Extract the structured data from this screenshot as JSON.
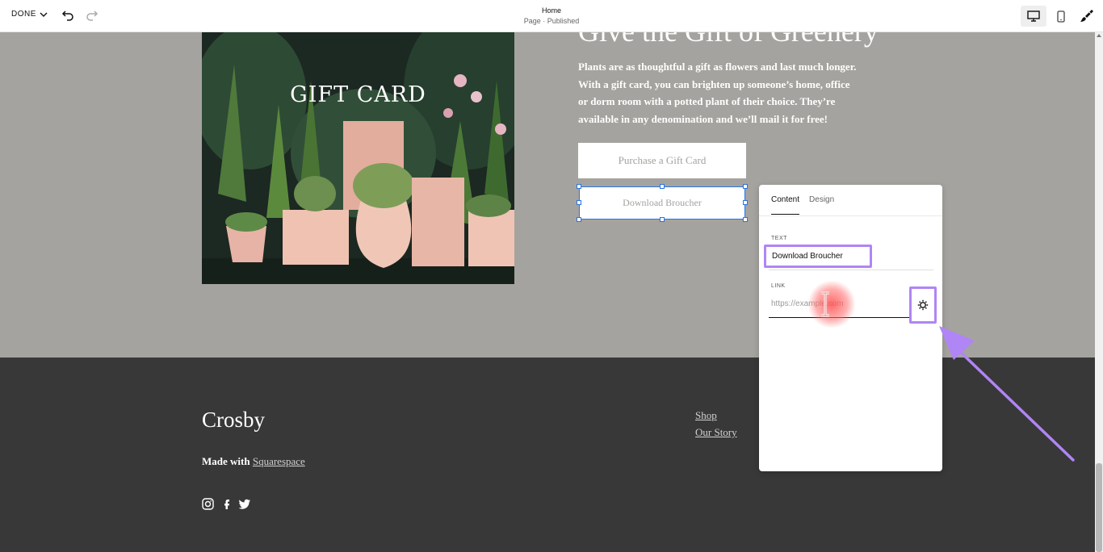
{
  "topbar": {
    "done_label": "DONE",
    "page_title": "Home",
    "page_status": "Page · Published",
    "icons": [
      "chevron-down-icon",
      "undo-icon",
      "redo-icon",
      "desktop-icon",
      "mobile-icon",
      "brush-icon"
    ]
  },
  "hero": {
    "image_caption": "GIFT CARD",
    "headline": "Give the Gift of Greenery",
    "body": "Plants are as thoughtful a gift as flowers and last much longer. With a gift card, you can brighten up someone’s home, office or dorm room with a potted plant of their choice. They’re available in any denomination and we’ll mail it for free!",
    "primary_button": "Purchase a Gift Card",
    "secondary_button": "Download Broucher"
  },
  "footer": {
    "brand": "Crosby",
    "made_with_prefix": "Made with",
    "made_with_link": "Squarespace",
    "nav": [
      "Shop",
      "Our Story"
    ],
    "social_icons": [
      "instagram-icon",
      "facebook-icon",
      "twitter-icon"
    ]
  },
  "panel": {
    "tabs": [
      "Content",
      "Design"
    ],
    "active_tab": "Content",
    "text_label": "TEXT",
    "text_value": "Download Broucher",
    "link_label": "LINK",
    "link_placeholder": "https://example.com"
  },
  "colors": {
    "section_bg": "#a5a39f",
    "footer_bg": "#383838",
    "selection_blue": "#2b74e0",
    "highlight_purple": "#b085f5",
    "button_text": "#a4a29e"
  }
}
